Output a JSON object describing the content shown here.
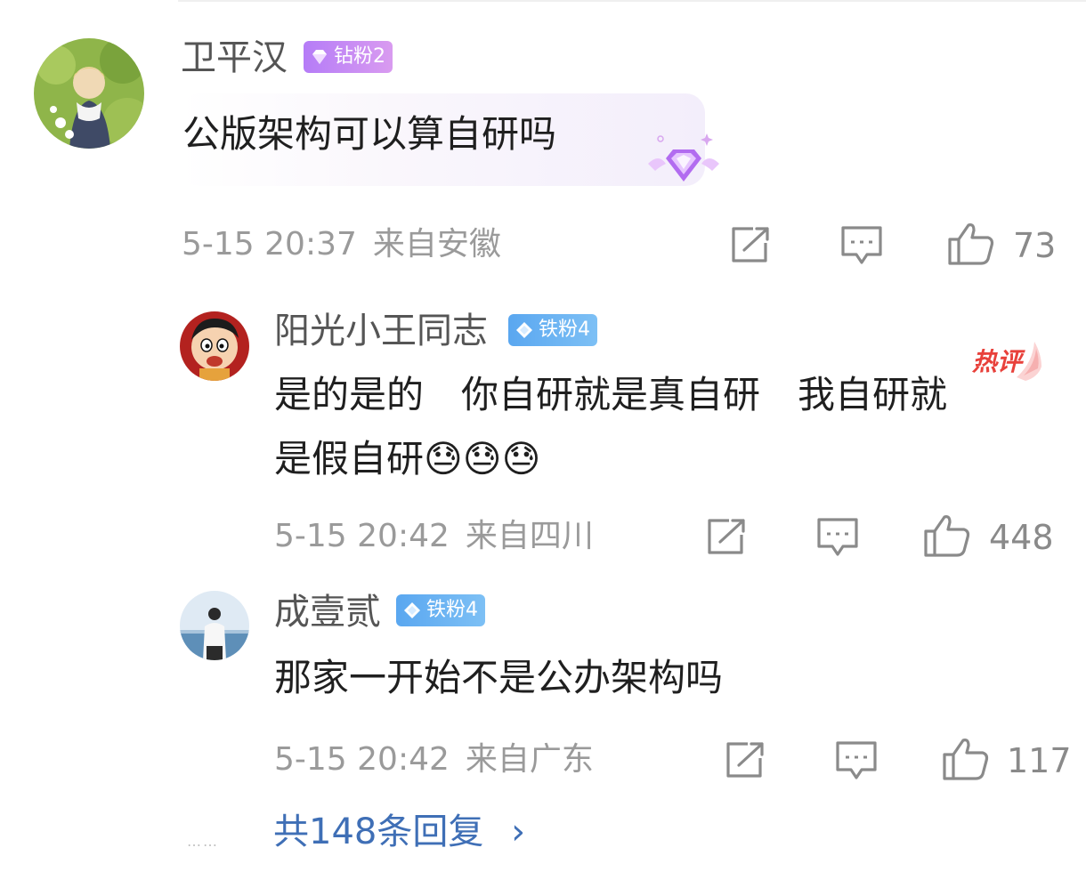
{
  "comment": {
    "user": "卫平汉",
    "badge": "钻粉2",
    "text": "公版架构可以算自研吗",
    "time": "5-15 20:37",
    "location": "来自安徽",
    "likes": "73"
  },
  "replies": [
    {
      "user": "阳光小王同志",
      "badge": "铁粉4",
      "text_line1": "是的是的　你自研就是真自研　我自研就",
      "text_line2": "是假自研😓😓😓",
      "hot_label": "热评",
      "time": "5-15 20:42",
      "location": "来自四川",
      "likes": "448"
    },
    {
      "user": "成壹贰",
      "badge": "铁粉4",
      "text": "那家一开始不是公办架构吗",
      "time": "5-15 20:42",
      "location": "来自广东",
      "likes": "117"
    }
  ],
  "more_replies": {
    "dots": "……",
    "label": "共148条回复",
    "arrow": "›"
  },
  "icons": {
    "share": "share-icon",
    "comment": "comment-icon",
    "like": "thumbs-up-icon",
    "badge_gem": "diamond-gem-icon"
  },
  "colors": {
    "diamond_badge": "#b57cf7",
    "iron_badge": "#5aa7f0",
    "link": "#3f6fb6",
    "meta": "#9a9a9a"
  }
}
